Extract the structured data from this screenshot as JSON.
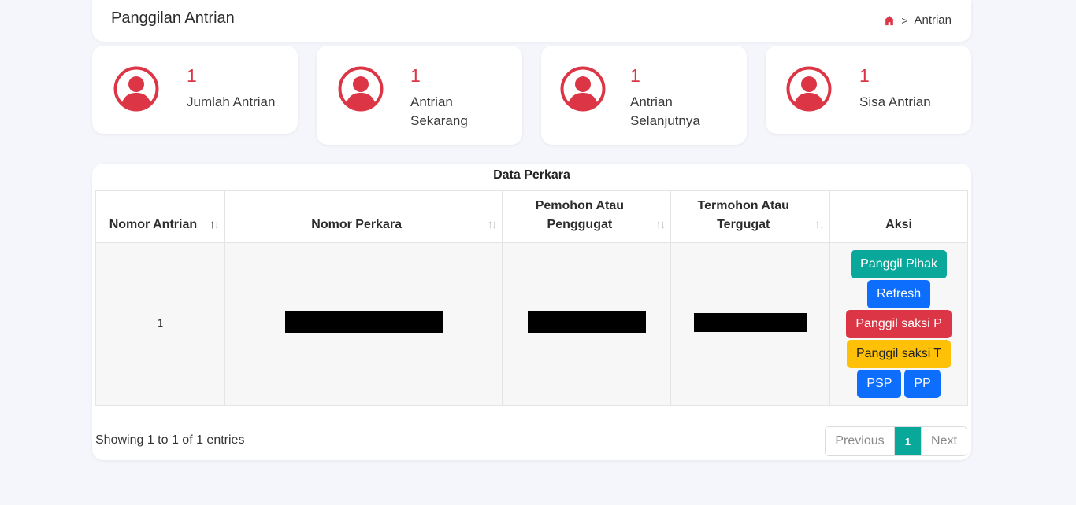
{
  "header": {
    "title": "Panggilan Antrian",
    "breadcrumb_current": "Antrian",
    "breadcrumb_separator": ">"
  },
  "stats": [
    {
      "value": "1",
      "label": "Jumlah Antrian",
      "icon": "user-circle-icon"
    },
    {
      "value": "1",
      "label": "Antrian Sekarang",
      "icon": "user-circle-icon"
    },
    {
      "value": "1",
      "label": "Antrian Selanjutnya",
      "icon": "user-circle-icon"
    },
    {
      "value": "1",
      "label": "Sisa Antrian",
      "icon": "user-circle-icon"
    }
  ],
  "table": {
    "title": "Data Perkara",
    "columns": [
      "Nomor Antrian",
      "Nomor Perkara",
      "Pemohon Atau Penggugat",
      "Termohon Atau Tergugat",
      "Aksi"
    ],
    "rows": [
      {
        "nomor_antrian": "1"
      }
    ],
    "actions": {
      "panggil_pihak": "Panggil Pihak",
      "refresh": "Refresh",
      "panggil_saksi_p": "Panggil saksi P",
      "panggil_saksi_t": "Panggil saksi T",
      "psp": "PSP",
      "pp": "PP"
    },
    "info": "Showing 1 to 1 of 1 entries",
    "pagination": {
      "previous": "Previous",
      "current": "1",
      "next": "Next"
    }
  },
  "colors": {
    "accent_red": "#dc3545",
    "teal": "#0aa89a",
    "blue": "#0d6efd",
    "yellow": "#ffc107"
  }
}
